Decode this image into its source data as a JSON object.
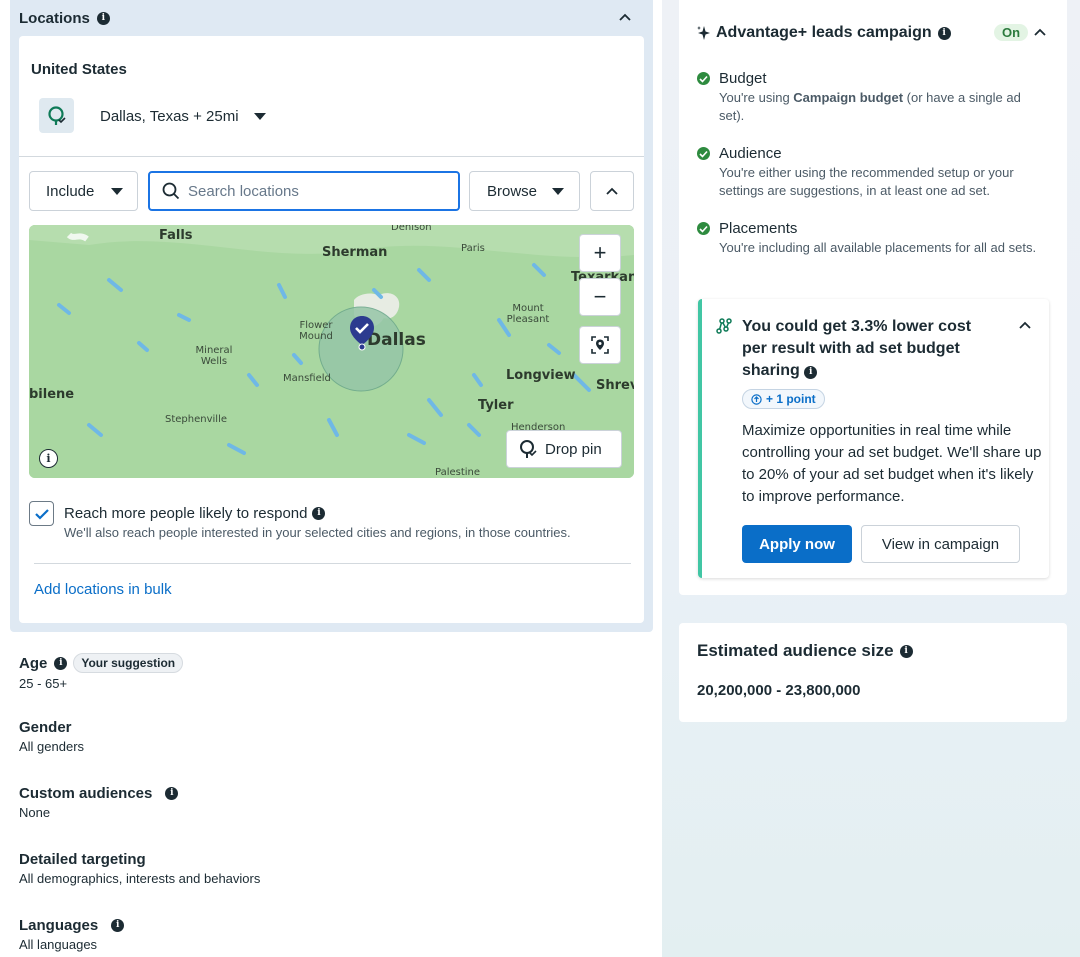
{
  "locations": {
    "title": "Locations",
    "country": "United States",
    "selected_location": "Dallas, Texas + 25mi",
    "include_label": "Include",
    "search_placeholder": "Search locations",
    "browse_label": "Browse",
    "map": {
      "labels": [
        "Falls",
        "Denison",
        "Sherman",
        "Paris",
        "Texarkana",
        "Mount Pleasant",
        "Flower Mound",
        "Dallas",
        "Mineral Wells",
        "Mansfield",
        "Longview",
        "Shreve",
        "bilene",
        "Tyler",
        "Stephenville",
        "Henderson",
        "Palestine"
      ],
      "drop_pin_label": "Drop pin",
      "zoom_in": "+",
      "zoom_out": "−",
      "water_color": "#6fb8e6",
      "land_color": "#a9d7a1"
    },
    "reach_more_title": "Reach more people likely to respond",
    "reach_more_sub": "We'll also reach people interested in your selected cities and regions, in those countries.",
    "reach_more_checked": true,
    "add_bulk": "Add locations in bulk"
  },
  "fields": [
    {
      "label": "Age",
      "value": "25 - 65+",
      "badge": "Your suggestion"
    },
    {
      "label": "Gender",
      "value": "All genders"
    },
    {
      "label": "Custom audiences",
      "value": "None"
    },
    {
      "label": "Detailed targeting",
      "value": "All demographics, interests and behaviors"
    },
    {
      "label": "Languages",
      "value": "All languages"
    }
  ],
  "advantage": {
    "title": "Advantage+ leads campaign",
    "status": "On",
    "items": [
      {
        "title": "Budget",
        "sub_pre": "You're using ",
        "sub_bold": "Campaign budget",
        "sub_post": " (or have a single ad set)."
      },
      {
        "title": "Audience",
        "sub": "You're either using the recommended setup or your settings are suggestions, in at least one ad set."
      },
      {
        "title": "Placements",
        "sub": "You're including all available placements for all ad sets."
      }
    ],
    "recommendation": {
      "title": "You could get 3.3% lower cost per result with ad set budget sharing",
      "badge": "+ 1 point",
      "body": "Maximize opportunities in real time while controlling your ad set budget. We'll share up to 20% of your ad set budget when it's likely to improve performance.",
      "apply": "Apply now",
      "view": "View in campaign"
    }
  },
  "estimated": {
    "title": "Estimated audience size",
    "range": "20,200,000 - 23,800,000"
  },
  "colors": {
    "primary": "#0a6ec8",
    "success": "#2e8b3f",
    "accent_teal": "#41c6a4"
  }
}
